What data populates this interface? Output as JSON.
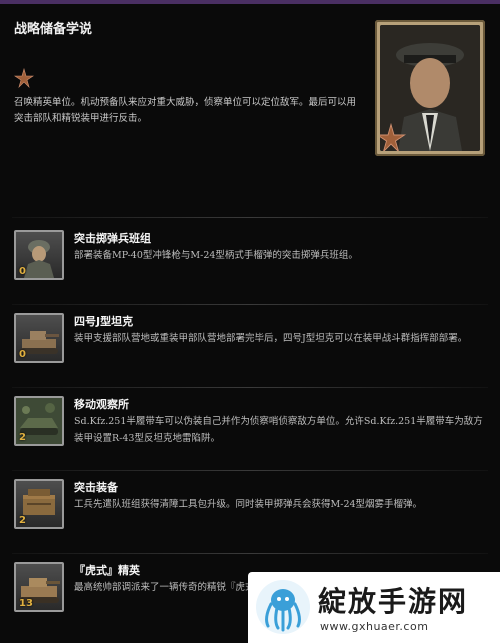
{
  "panel": {
    "title": "战略储备学说",
    "intro": "召唤精英单位。机动预备队来应对重大威胁，侦察单位可以定位敌军。最后可以用突击部队和精锐装甲进行反击。"
  },
  "abilities": [
    {
      "title": "突击掷弹兵班组",
      "cost": "0",
      "icon": "soldier-icon",
      "desc": "部署装备MP-40型冲锋枪与M-24型柄式手榴弹的突击掷弹兵班组。"
    },
    {
      "title": "四号J型坦克",
      "cost": "0",
      "icon": "tank-icon",
      "desc": "装甲支援部队营地或重装甲部队营地部署完毕后，四号J型坦克可以在装甲战斗群指挥部部署。"
    },
    {
      "title": "移动观察所",
      "cost": "2",
      "icon": "halftrack-icon",
      "desc": "Sd.Kfz.251半履带车可以伪装自己并作为侦察哨侦察敌方单位。允许Sd.Kfz.251半履带车为敌方装甲设置R-43型反坦克地雷陷阱。"
    },
    {
      "title": "突击装备",
      "cost": "2",
      "icon": "equipment-crate-icon",
      "desc": "工兵先遣队班组获得清障工具包升级。同时装甲掷弹兵会获得M-24型烟雾手榴弹。"
    },
    {
      "title": "『虎式』精英",
      "cost": "13",
      "icon": "tiger-tank-icon",
      "desc": "最高统帅部调派来了一辆传奇的精锐『虎式』坦克。重装甲部队营地部署后可"
    }
  ],
  "watermark": {
    "brand": "綻放手游网",
    "url": "www.gxhuaer.com"
  },
  "colors": {
    "background": "#0a0a0a",
    "cost": "#e0b040",
    "frame": "#b7a17a"
  }
}
